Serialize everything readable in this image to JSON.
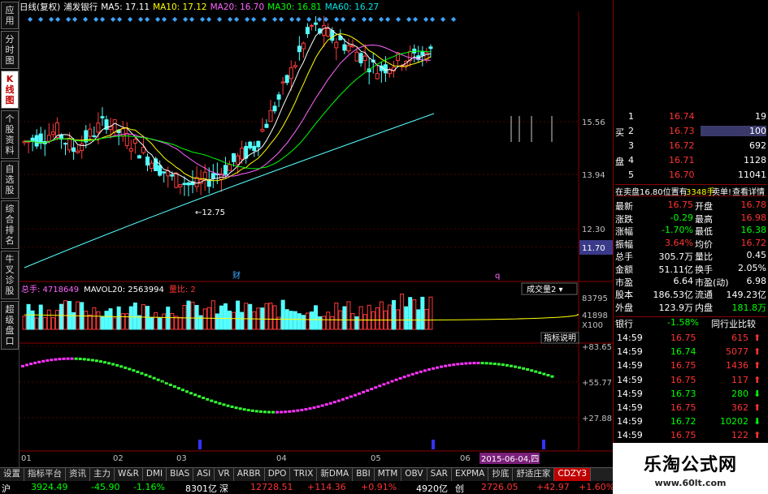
{
  "left_tabs": [
    {
      "label": "应用",
      "active": false
    },
    {
      "label": "分时图",
      "active": false
    },
    {
      "label": "K线图",
      "active": true
    },
    {
      "label": "个股资料",
      "active": false
    },
    {
      "label": "自选股",
      "active": false
    },
    {
      "label": "综合排名",
      "active": false
    },
    {
      "label": "牛叉诊股",
      "active": false
    },
    {
      "label": "超级盘口",
      "active": false
    }
  ],
  "header": {
    "period": "日线(复权)",
    "stock": "浦发银行",
    "ma5": "MA5: 17.11",
    "ma10": "MA10: 17.12",
    "ma20": "MA20: 16.70",
    "ma30": "MA30: 16.81",
    "ma60": "MA60: 16.27"
  },
  "price_axis": [
    "15.56",
    "13.94",
    "12.30",
    "11.70"
  ],
  "annotations": {
    "low": "12.75",
    "fin": "财",
    "q": "q"
  },
  "volume_header": {
    "total": "总手: 4718649",
    "mavol": "MAVOL20: 2563994",
    "ratio": "量比: 2"
  },
  "volume_axis": [
    "83795",
    "41898",
    "X100"
  ],
  "volume_select": "成交量2",
  "indicator_help": "指标说明",
  "indicator_axis": [
    "83.65",
    "55.77",
    "27.88"
  ],
  "x_axis": [
    "01",
    "02",
    "03",
    "04",
    "05",
    "06",
    "07"
  ],
  "date_label": "2015-06-04,四",
  "bottom_tabs": [
    "设置",
    "指标平台",
    "资讯",
    "主力",
    "W&R",
    "DMI",
    "BIAS",
    "ASI",
    "VR",
    "ARBR",
    "DPO",
    "TRIX",
    "新DMA",
    "BBI",
    "MTM",
    "OBV",
    "SAR",
    "EXPMA",
    "抄底",
    "舒适庄家",
    "CDZY3"
  ],
  "status": {
    "idx1_name": "沪",
    "idx1_val": "3924.49",
    "idx1_chg": "-45.90",
    "idx1_pct": "-1.16%",
    "idx1_amt": "8301亿",
    "idx2_name": "深",
    "idx2_val": "12728.51",
    "idx2_chg": "+114.36",
    "idx2_pct": "+0.91%",
    "idx2_amt": "4920亿",
    "idx3_name": "创",
    "idx3_val": "2726.05",
    "idx3_chg": "+42.97",
    "idx3_pct": "+1.60%"
  },
  "order_book": [
    {
      "side": "",
      "level": "1",
      "price": "16.74",
      "vol": "19"
    },
    {
      "side": "买",
      "level": "2",
      "price": "16.73",
      "vol": "100"
    },
    {
      "side": "",
      "level": "3",
      "price": "16.72",
      "vol": "692"
    },
    {
      "side": "盘",
      "level": "4",
      "price": "16.71",
      "vol": "1128"
    },
    {
      "side": "",
      "level": "5",
      "price": "16.70",
      "vol": "11041"
    }
  ],
  "sell_notice": {
    "a": "在卖盘16.80位置有",
    "b": "3348手",
    "c": "卖单!",
    "d": "查看详情"
  },
  "quote": [
    {
      "l1": "最新",
      "v1": "16.75",
      "l2": "开盘",
      "v2": "16.78"
    },
    {
      "l1": "涨跌",
      "v1": "-0.29",
      "l2": "最高",
      "v2": "16.98"
    },
    {
      "l1": "涨幅",
      "v1": "-1.70%",
      "l2": "最低",
      "v2": "16.38"
    },
    {
      "l1": "振幅",
      "v1": "3.64%",
      "l2": "均价",
      "v2": "16.72"
    },
    {
      "l1": "总手",
      "v1": "305.7万",
      "l2": "量比",
      "v2": "0.45"
    },
    {
      "l1": "金额",
      "v1": "51.11亿",
      "l2": "换手",
      "v2": "2.05%"
    },
    {
      "l1": "市盈",
      "v1": "6.64",
      "l2": "市盈(动)",
      "v2": "6.98"
    },
    {
      "l1": "股本",
      "v1": "186.53亿",
      "l2": "流通",
      "v2": "149.23亿"
    },
    {
      "l1": "外盘",
      "v1": "123.9万",
      "l2": "内盘",
      "v2": "181.8万"
    }
  ],
  "industry": {
    "name": "银行",
    "pct": "-1.58%",
    "compare": "同行业比较"
  },
  "ticks": [
    {
      "time": "14:59",
      "price": "16.75",
      "vol": "615",
      "dir": "up"
    },
    {
      "time": "14:59",
      "price": "16.74",
      "vol": "5077",
      "dir": "up"
    },
    {
      "time": "14:59",
      "price": "16.75",
      "vol": "1436",
      "dir": "up"
    },
    {
      "time": "14:59",
      "price": "16.75",
      "vol": "117",
      "dir": "up"
    },
    {
      "time": "14:59",
      "price": "16.73",
      "vol": "280",
      "dir": "down"
    },
    {
      "time": "14:59",
      "price": "16.75",
      "vol": "362",
      "dir": "up"
    },
    {
      "time": "14:59",
      "price": "16.72",
      "vol": "10202",
      "dir": "down"
    },
    {
      "time": "14:59",
      "price": "16.75",
      "vol": "122",
      "dir": "up"
    }
  ],
  "logo": {
    "title": "乐淘公式网",
    "url": "www.60lt.com"
  }
}
